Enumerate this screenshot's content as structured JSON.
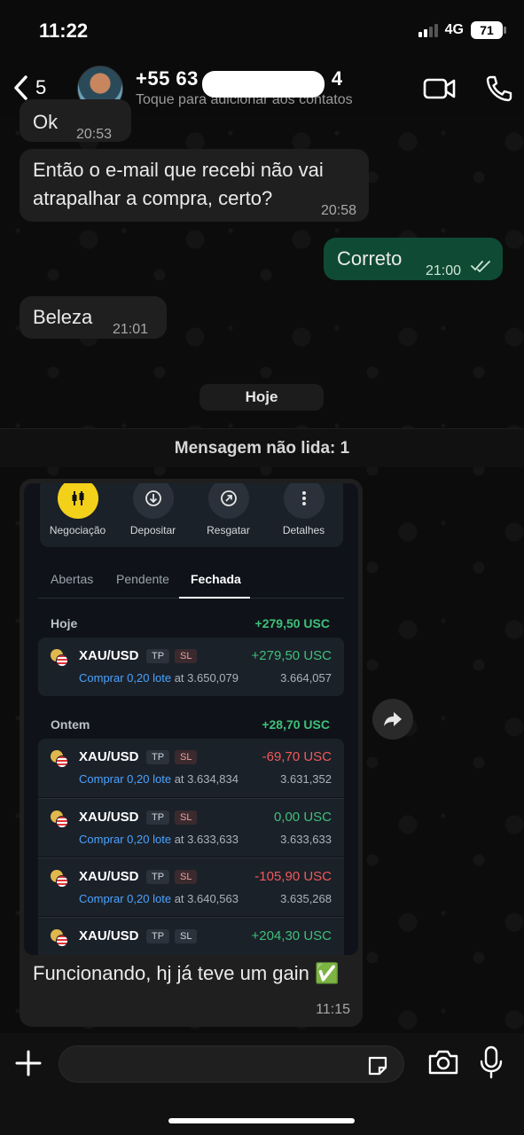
{
  "status": {
    "time": "11:22",
    "network": "4G",
    "battery": "71"
  },
  "header": {
    "back_count": "5",
    "contact_name": "+55 63",
    "contact_name_tail": "4",
    "contact_sub": "Toque para adicionar aos contatos"
  },
  "messages": [
    {
      "dir": "in",
      "text": "Ok",
      "time": "20:53"
    },
    {
      "dir": "in",
      "text": "Então o e-mail que recebi não vai atrapalhar a compra, certo?",
      "time": "20:58"
    },
    {
      "dir": "out",
      "text": "Correto",
      "time": "21:00",
      "status": "read"
    },
    {
      "dir": "in",
      "text": "Beleza",
      "time": "21:01"
    }
  ],
  "date_separator": "Hoje",
  "unread_banner": "Mensagem não lida: 1",
  "image_message": {
    "caption": "Funcionando, hj já teve um gain ✅",
    "time": "11:15",
    "screenshot": {
      "actions": [
        {
          "label": "Negociação",
          "icon": "candles-icon"
        },
        {
          "label": "Depositar",
          "icon": "deposit-icon"
        },
        {
          "label": "Resgatar",
          "icon": "withdraw-icon"
        },
        {
          "label": "Detalhes",
          "icon": "more-icon"
        }
      ],
      "tabs": [
        "Abertas",
        "Pendente",
        "Fechada"
      ],
      "active_tab": "Fechada",
      "groups": [
        {
          "label": "Hoje",
          "total": "+279,50 USC",
          "trades": [
            {
              "symbol": "XAU/USD",
              "tp": "TP",
              "sl": "SL",
              "pnl": "+279,50 USC",
              "side": "Comprar 0,20 lote",
              "at": "at 3.650,079",
              "current": "3.664,057"
            }
          ]
        },
        {
          "label": "Ontem",
          "total": "+28,70 USC",
          "trades": [
            {
              "symbol": "XAU/USD",
              "tp": "TP",
              "sl": "SL",
              "pnl": "-69,70 USC",
              "side": "Comprar 0,20 lote",
              "at": "at 3.634,834",
              "current": "3.631,352"
            },
            {
              "symbol": "XAU/USD",
              "tp": "TP",
              "sl": "SL",
              "pnl": "0,00 USC",
              "side": "Comprar 0,20 lote",
              "at": "at 3.633,633",
              "current": "3.633,633"
            },
            {
              "symbol": "XAU/USD",
              "tp": "TP",
              "sl": "SL",
              "pnl": "-105,90 USC",
              "side": "Comprar 0,20 lote",
              "at": "at 3.640,563",
              "current": "3.635,268"
            },
            {
              "symbol": "XAU/USD",
              "tp": "TP",
              "sl": "SL",
              "pnl": "+204,30 USC"
            }
          ]
        }
      ]
    }
  },
  "composer": {
    "placeholder": ""
  },
  "colors": {
    "outgoing": "#0f4b34",
    "incoming": "#1f1f1f",
    "positive": "#3fc07a",
    "negative": "#f0595a",
    "link": "#4aa3ff",
    "accent_yellow": "#f3d11b"
  }
}
